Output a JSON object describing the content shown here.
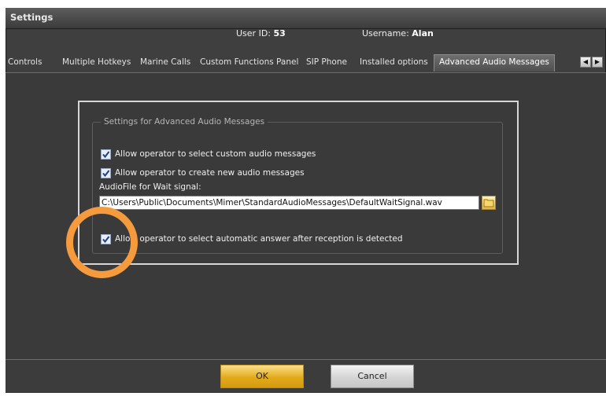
{
  "window": {
    "title": "Settings"
  },
  "user": {
    "id_label": "User ID:",
    "id_value": "53",
    "username_label": "Username:",
    "username_value": "Alan"
  },
  "tabs": [
    {
      "label": "Controls",
      "active": false
    },
    {
      "label": "Multiple Hotkeys",
      "active": false
    },
    {
      "label": "Marine Calls",
      "active": false
    },
    {
      "label": "Custom Functions Panel",
      "active": false
    },
    {
      "label": "SIP Phone",
      "active": false
    },
    {
      "label": "Installed options",
      "active": false
    },
    {
      "label": "Advanced Audio Messages",
      "active": true
    }
  ],
  "tab_scroll": {
    "left_icon": "arrow-left-icon",
    "right_icon": "arrow-right-icon"
  },
  "group": {
    "title": "Settings for Advanced Audio Messages",
    "checkboxes": [
      {
        "label": "Allow operator to select custom audio messages",
        "checked": true
      },
      {
        "label": "Allow operator to create new audio messages",
        "checked": true
      },
      {
        "label": "Allow operator to select automatic answer after reception is detected",
        "checked": true
      }
    ],
    "audio_file_label": "AudioFile for Wait signal:",
    "audio_file_value": "C:\\Users\\Public\\Documents\\Mimer\\StandardAudioMessages\\DefaultWaitSignal.wav",
    "browse_icon": "folder-browse-icon"
  },
  "buttons": {
    "ok": "OK",
    "cancel": "Cancel"
  },
  "colors": {
    "accent_ok": "#e2aa1a",
    "highlight_ring": "#f59b3d",
    "background": "#3a3a3a"
  }
}
